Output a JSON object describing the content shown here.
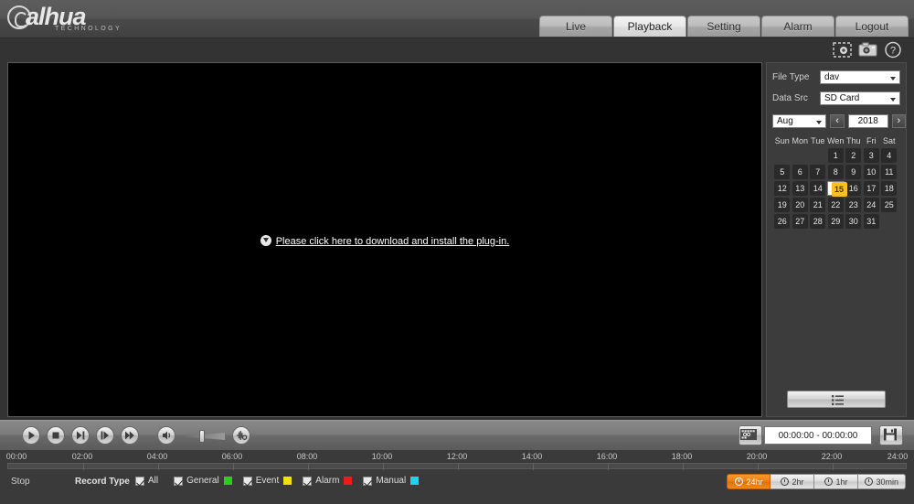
{
  "brand": {
    "name": "alhua",
    "tagline": "TECHNOLOGY"
  },
  "nav": {
    "tabs": [
      {
        "label": "Live",
        "active": false
      },
      {
        "label": "Playback",
        "active": true
      },
      {
        "label": "Setting",
        "active": false
      },
      {
        "label": "Alarm",
        "active": false
      },
      {
        "label": "Logout",
        "active": false
      }
    ]
  },
  "top_icons": [
    {
      "name": "digital-zoom-icon",
      "title": "Digital Zoom"
    },
    {
      "name": "snapshot-icon",
      "title": "Snapshot"
    },
    {
      "name": "help-icon",
      "title": "Help"
    }
  ],
  "video": {
    "plugin_prompt": "Please click here to download and install the plug-in."
  },
  "right_panel": {
    "file_type": {
      "label": "File Type",
      "value": "dav"
    },
    "data_src": {
      "label": "Data Src",
      "value": "SD Card"
    },
    "month": "Aug",
    "year": "2018",
    "prev_arrow": "‹",
    "next_arrow": "›",
    "weekdays": [
      "Sun",
      "Mon",
      "Tue",
      "Wen",
      "Thu",
      "Fri",
      "Sat"
    ],
    "weeks": [
      [
        "",
        "",
        "",
        "1",
        "2",
        "3",
        "4"
      ],
      [
        "5",
        "6",
        "7",
        "8",
        "9",
        "10",
        "11"
      ],
      [
        "12",
        "13",
        "14",
        "15",
        "16",
        "17",
        "18"
      ],
      [
        "19",
        "20",
        "21",
        "22",
        "23",
        "24",
        "25"
      ],
      [
        "26",
        "27",
        "28",
        "29",
        "30",
        "31",
        ""
      ]
    ],
    "selected_day": "15",
    "file_list_button": "file-list-button"
  },
  "controls": {
    "buttons": [
      {
        "name": "play-button",
        "icon": "play"
      },
      {
        "name": "stop-button",
        "icon": "stop"
      },
      {
        "name": "next-frame-button",
        "icon": "next-frame"
      },
      {
        "name": "slow-play-button",
        "icon": "slow"
      },
      {
        "name": "fast-play-button",
        "icon": "fast"
      }
    ],
    "volume_button": "volume-button",
    "volume_level": 40,
    "audio_toggle": "audio-mute-button",
    "clip_button": "video-clip-button",
    "save_button": "save-button",
    "time_range": "00:00:00 - 00:00:00"
  },
  "timeline": {
    "labels": [
      "00:00",
      "02:00",
      "04:00",
      "06:00",
      "08:00",
      "10:00",
      "12:00",
      "14:00",
      "16:00",
      "18:00",
      "20:00",
      "22:00",
      "24:00"
    ]
  },
  "status": {
    "state": "Stop",
    "record_type_label": "Record Type",
    "record_types": [
      {
        "label": "All",
        "color": "",
        "checked": true
      },
      {
        "label": "General",
        "color": "#2ecc1e",
        "checked": true
      },
      {
        "label": "Event",
        "color": "#f2e00c",
        "checked": true
      },
      {
        "label": "Alarm",
        "color": "#ef1b1b",
        "checked": true
      },
      {
        "label": "Manual",
        "color": "#16d6ea",
        "checked": true
      }
    ],
    "zoom_levels": [
      {
        "label": "24hr",
        "active": true
      },
      {
        "label": "2hr",
        "active": false
      },
      {
        "label": "1hr",
        "active": false
      },
      {
        "label": "30min",
        "active": false
      }
    ]
  }
}
